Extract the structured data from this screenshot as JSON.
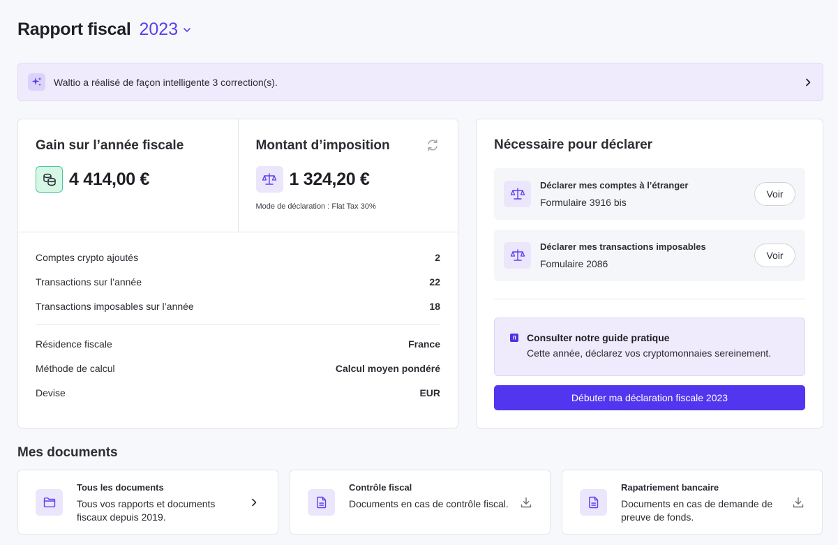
{
  "header": {
    "title": "Rapport fiscal",
    "year": "2023"
  },
  "banner": {
    "text": "Waltio a réalisé de façon intelligente 3 correction(s)."
  },
  "gain": {
    "title": "Gain sur l’année fiscale",
    "value": "4 414,00 €"
  },
  "tax": {
    "title": "Montant d’imposition",
    "value": "1 324,20 €",
    "mode": "Mode de déclaration : Flat Tax 30%"
  },
  "stats": [
    {
      "label": "Comptes crypto ajoutés",
      "value": "2"
    },
    {
      "label": "Transactions sur l’année",
      "value": "22"
    },
    {
      "label": "Transactions imposables sur l’année",
      "value": "18"
    }
  ],
  "settings": [
    {
      "label": "Résidence fiscale",
      "value": "France"
    },
    {
      "label": "Méthode de calcul",
      "value": "Calcul moyen pondéré"
    },
    {
      "label": "Devise",
      "value": "EUR"
    }
  ],
  "required": {
    "title": "Nécessaire pour déclarer",
    "items": [
      {
        "title": "Déclarer mes comptes à l’étranger",
        "subtitle": "Formulaire 3916 bis",
        "button": "Voir"
      },
      {
        "title": "Déclarer mes transactions imposables",
        "subtitle": "Fomulaire 2086",
        "button": "Voir"
      }
    ],
    "guide_title": "Consulter notre guide pratique",
    "guide_subtitle": "Cette année, déclarez vos cryptomonnaies sereinement.",
    "cta": "Débuter ma déclaration fiscale 2023"
  },
  "documents": {
    "title": "Mes documents",
    "items": [
      {
        "title": "Tous les documents",
        "subtitle": "Tous vos rapports et documents fiscaux depuis 2019.",
        "icon": "folder-icon",
        "action": "chevron-right-icon"
      },
      {
        "title": "Contrôle fiscal",
        "subtitle": "Documents en cas de contrôle fiscal.",
        "icon": "document-icon",
        "action": "download-icon"
      },
      {
        "title": "Rapatriement bancaire",
        "subtitle": "Documents en cas de demande de preuve de fonds.",
        "icon": "document-icon",
        "action": "download-icon"
      }
    ]
  },
  "colors": {
    "accent": "#5236ef",
    "banner_bg": "#efeafc",
    "gain_icon_bg": "#d6f6e6"
  }
}
